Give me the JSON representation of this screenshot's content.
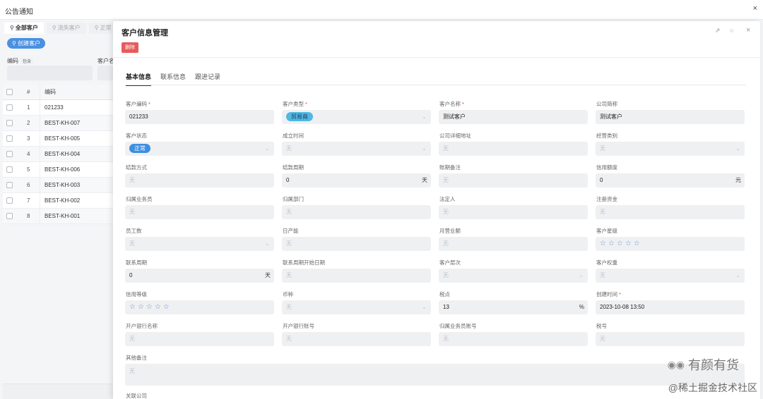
{
  "bg": {
    "title": "公告通知",
    "close": "×",
    "tabs": [
      "全部客户",
      "流失客户",
      "正常"
    ],
    "create_button": "创建客户",
    "labels": [
      "编码",
      "客户名"
    ],
    "chip": "包含",
    "table": {
      "headers": [
        "#",
        "编码"
      ],
      "rows": [
        {
          "idx": "1",
          "code": "021233"
        },
        {
          "idx": "2",
          "code": "BEST-KH-007"
        },
        {
          "idx": "3",
          "code": "BEST-KH-005"
        },
        {
          "idx": "4",
          "code": "BEST-KH-004"
        },
        {
          "idx": "5",
          "code": "BEST-KH-006"
        },
        {
          "idx": "6",
          "code": "BEST-KH-003"
        },
        {
          "idx": "7",
          "code": "BEST-KH-002"
        },
        {
          "idx": "8",
          "code": "BEST-KH-001"
        }
      ]
    }
  },
  "modal": {
    "title": "客户信息管理",
    "delete_button": "删除",
    "tabs": [
      "基本信息",
      "联系信息",
      "跟进记录"
    ],
    "fields": [
      {
        "label": "客户编码",
        "required": true,
        "value": "021233"
      },
      {
        "label": "客户类型",
        "required": true,
        "pill": "贸易商"
      },
      {
        "label": "客户名称",
        "required": true,
        "value": "测试客户"
      },
      {
        "label": "公司简称",
        "required": false,
        "value": "测试客户"
      },
      {
        "label": "客户状态",
        "required": false,
        "pill": "正常"
      },
      {
        "label": "成立时间",
        "required": false,
        "placeholder": "无"
      },
      {
        "label": "公司详细地址",
        "required": false,
        "placeholder": "无"
      },
      {
        "label": "经营类别",
        "required": false,
        "placeholder": "无"
      },
      {
        "label": "结款方式",
        "required": false,
        "placeholder": "无"
      },
      {
        "label": "结款周期",
        "required": false,
        "value": "0",
        "unit": "天"
      },
      {
        "label": "账期备注",
        "required": false,
        "placeholder": "无"
      },
      {
        "label": "信用额度",
        "required": false,
        "value": "0",
        "unit": "元"
      },
      {
        "label": "归属业务员",
        "required": false,
        "placeholder": "无"
      },
      {
        "label": "归属部门",
        "required": false,
        "placeholder": "无"
      },
      {
        "label": "法定人",
        "required": false,
        "placeholder": "无"
      },
      {
        "label": "注册资金",
        "required": false,
        "placeholder": "无"
      },
      {
        "label": "员工数",
        "required": false,
        "placeholder": "无"
      },
      {
        "label": "日产能",
        "required": false,
        "placeholder": "无"
      },
      {
        "label": "月营业额",
        "required": false,
        "placeholder": "无"
      },
      {
        "label": "客户星级",
        "required": false,
        "stars": "☆☆☆☆☆"
      },
      {
        "label": "联系周期",
        "required": false,
        "value": "0",
        "unit": "天"
      },
      {
        "label": "联系周期开始日期",
        "required": false,
        "placeholder": "无"
      },
      {
        "label": "客户层次",
        "required": false,
        "placeholder": "无"
      },
      {
        "label": "客户权重",
        "required": false,
        "placeholder": "无"
      },
      {
        "label": "信用等级",
        "required": false,
        "stars": "☆☆☆☆☆"
      },
      {
        "label": "币种",
        "required": false,
        "placeholder": "无"
      },
      {
        "label": "税点",
        "required": false,
        "value": "13",
        "unit": "%"
      },
      {
        "label": "创建时间",
        "required": true,
        "value": "2023-10-08 13:50"
      },
      {
        "label": "开户银行名称",
        "required": false,
        "placeholder": "无"
      },
      {
        "label": "开户银行账号",
        "required": false,
        "placeholder": "无"
      },
      {
        "label": "归属业务员账号",
        "required": false,
        "placeholder": "无"
      },
      {
        "label": "税号",
        "required": false,
        "placeholder": "无"
      }
    ],
    "remark": {
      "label": "其他备注",
      "placeholder": "无"
    },
    "cut_label": "关联公司"
  },
  "watermark": {
    "brand": "有颜有货",
    "community": "@稀土掘金技术社区"
  }
}
